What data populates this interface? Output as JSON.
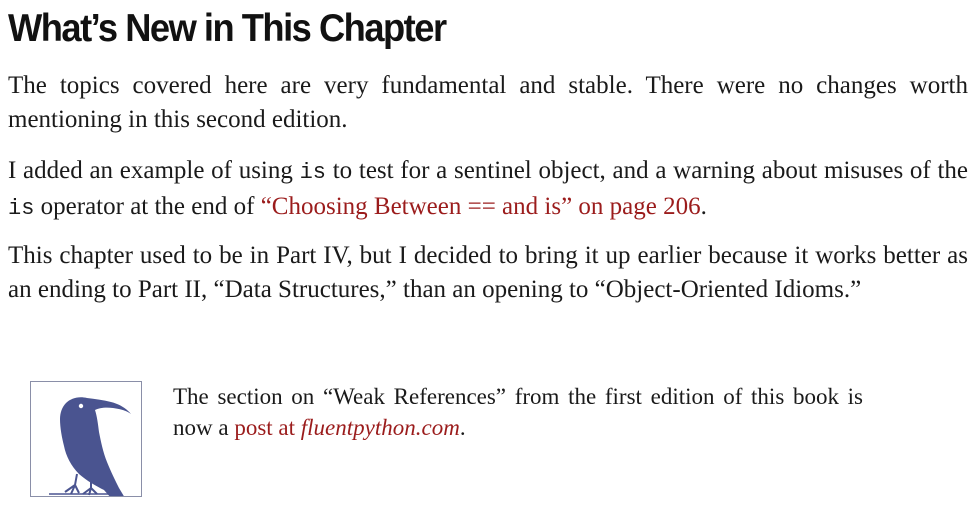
{
  "heading": "What’s New in This Chapter",
  "paragraphs": {
    "p1": "The topics covered here are very fundamental and stable. There were no changes worth mentioning in this second edition.",
    "p2": {
      "text_a": "I added an example of using ",
      "code_a": "is",
      "text_b": " to test for a sentinel object, and a warning about misuses of the ",
      "code_b": "is",
      "text_c": " operator at the end of ",
      "link": "“Choosing Between == and is” on page 206",
      "text_d": "."
    },
    "p3": "This chapter used to be in Part IV, but I decided to bring it up earlier because it works better as an ending to Part II, “Data Structures,” than an opening to “Object-Oriented Idioms.”"
  },
  "note": {
    "icon": "bird-icon",
    "text_a": "The section on “Weak References” from the first edition of this book is now a ",
    "link_a": "post at ",
    "link_b": "fluentpython.com",
    "text_b": "."
  },
  "colors": {
    "link": "#9b1c1c",
    "icon_fill": "#4a5490",
    "icon_border": "#8a8fa8",
    "text": "#1a1a1a"
  }
}
